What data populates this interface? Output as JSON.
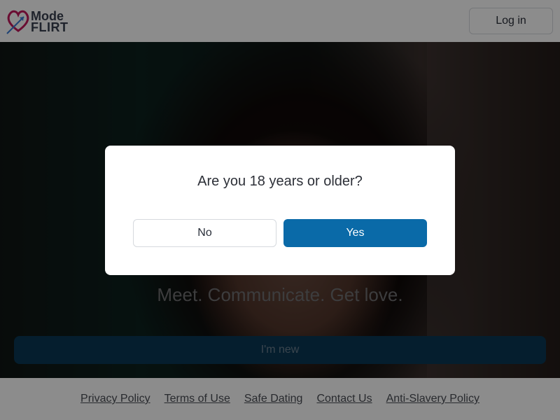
{
  "header": {
    "logo_line1": "Mode",
    "logo_line2": "FLIRT",
    "login_label": "Log in"
  },
  "hero": {
    "tagline": "Meet. Communicate. Get love.",
    "new_button_label": "I'm new"
  },
  "footer": {
    "links": [
      "Privacy Policy",
      "Terms of Use",
      "Safe Dating",
      "Contact Us",
      "Anti-Slavery Policy"
    ]
  },
  "modal": {
    "question": "Are you 18 years or older?",
    "no_label": "No",
    "yes_label": "Yes"
  },
  "colors": {
    "logo_heart": "#c2185b",
    "logo_arrow": "#3a7bd5",
    "primary": "#0a6aa8",
    "text_dark": "#2d3038"
  }
}
